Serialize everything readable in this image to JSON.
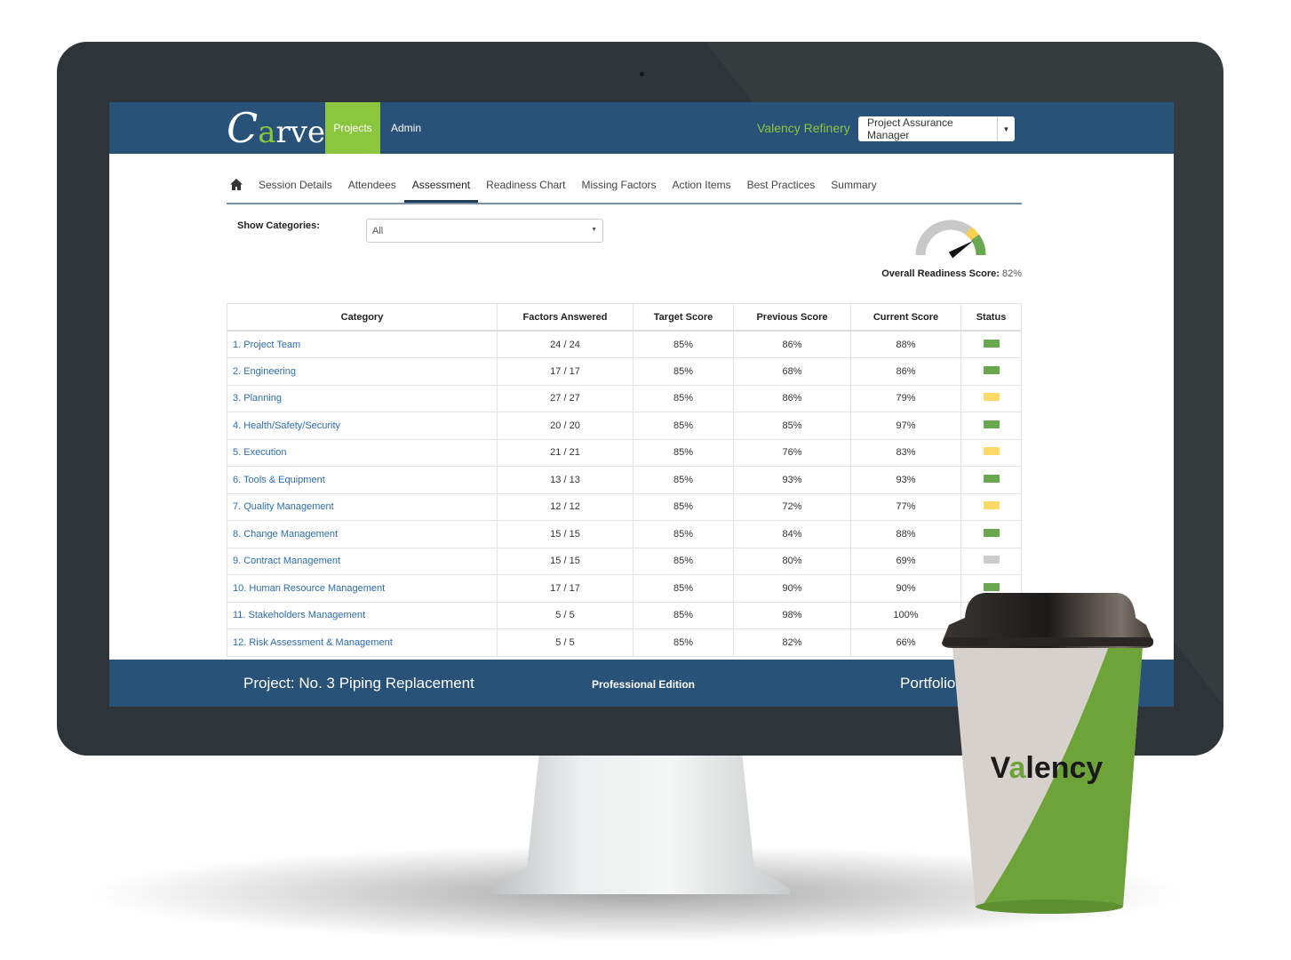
{
  "header": {
    "logo": "Carve",
    "nav": [
      "Projects",
      "Admin"
    ],
    "organization": "Valency Refinery",
    "role_select": "Project Assurance Manager"
  },
  "tabs": [
    "Session Details",
    "Attendees",
    "Assessment",
    "Readiness Chart",
    "Missing Factors",
    "Action Items",
    "Best Practices",
    "Summary"
  ],
  "active_tab": "Assessment",
  "filter": {
    "label": "Show Categories:",
    "value": "All"
  },
  "gauge": {
    "label": "Overall Readiness Score:",
    "value": "82%",
    "value_fraction": 0.82
  },
  "table": {
    "columns": [
      "Category",
      "Factors Answered",
      "Target Score",
      "Previous Score",
      "Current Score",
      "Status"
    ],
    "rows": [
      [
        "1. Project Team",
        "24 / 24",
        "85%",
        "86%",
        "88%",
        "green"
      ],
      [
        "2. Engineering",
        "17 / 17",
        "85%",
        "68%",
        "86%",
        "green"
      ],
      [
        "3. Planning",
        "27 / 27",
        "85%",
        "86%",
        "79%",
        "yellow"
      ],
      [
        "4. Health/Safety/Security",
        "20 / 20",
        "85%",
        "85%",
        "97%",
        "green"
      ],
      [
        "5. Execution",
        "21 / 21",
        "85%",
        "76%",
        "83%",
        "yellow"
      ],
      [
        "6. Tools & Equipment",
        "13 / 13",
        "85%",
        "93%",
        "93%",
        "green"
      ],
      [
        "7. Quality Management",
        "12 / 12",
        "85%",
        "72%",
        "77%",
        "yellow"
      ],
      [
        "8. Change Management",
        "15 / 15",
        "85%",
        "84%",
        "88%",
        "green"
      ],
      [
        "9. Contract Management",
        "15 / 15",
        "85%",
        "80%",
        "69%",
        "gray"
      ],
      [
        "10. Human Resource Management",
        "17 / 17",
        "85%",
        "90%",
        "90%",
        "green"
      ],
      [
        "11. Stakeholders Management",
        "5 / 5",
        "85%",
        "98%",
        "100%",
        ""
      ],
      [
        "12. Risk Assessment & Management",
        "5 / 5",
        "85%",
        "82%",
        "66%",
        ""
      ]
    ]
  },
  "status_colors": {
    "green": "#6aa84f",
    "yellow": "#ffd966",
    "gray": "#cccccc"
  },
  "footer": {
    "project": "Project: No. 3 Piping Replacement",
    "edition": "Professional Edition",
    "portfolio": "Portfolio:"
  },
  "cup_logo": "Valency"
}
